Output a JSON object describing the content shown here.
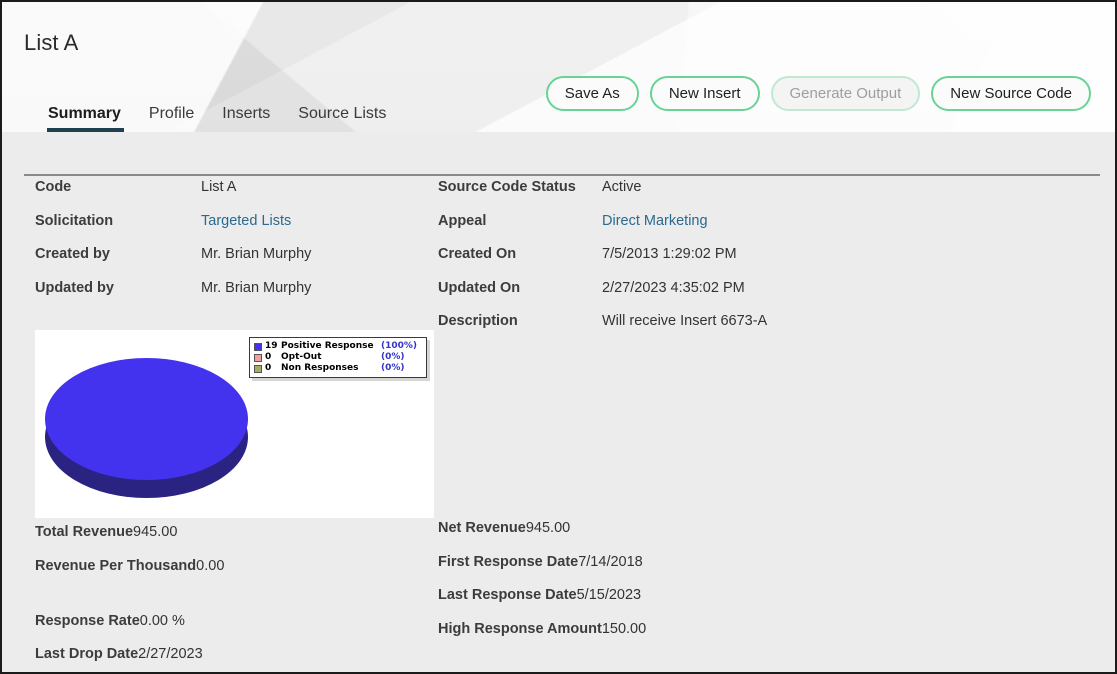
{
  "header": {
    "title": "List A"
  },
  "actions": [
    {
      "label": "Save As",
      "state": "enabled"
    },
    {
      "label": "New Insert",
      "state": "enabled"
    },
    {
      "label": "Generate Output",
      "state": "disabled"
    },
    {
      "label": "New Source Code",
      "state": "enabled"
    }
  ],
  "tabs": [
    {
      "label": "Summary",
      "active": true
    },
    {
      "label": "Profile",
      "active": false
    },
    {
      "label": "Inserts",
      "active": false
    },
    {
      "label": "Source Lists",
      "active": false
    }
  ],
  "details": {
    "left_top": [
      {
        "label": "Code",
        "value": "List A",
        "link": false
      },
      {
        "label": "Solicitation",
        "value": "Targeted Lists",
        "link": true
      },
      {
        "label": "Created by",
        "value": "Mr. Brian Murphy",
        "link": false
      },
      {
        "label": "Updated by",
        "value": "Mr. Brian Murphy",
        "link": false
      }
    ],
    "right_top": [
      {
        "label": "Source Code Status",
        "value": "Active",
        "link": false
      },
      {
        "label": "Appeal",
        "value": "Direct Marketing",
        "link": true
      },
      {
        "label": "Created On",
        "value": "7/5/2013 1:29:02 PM",
        "link": false
      },
      {
        "label": "Updated On",
        "value": "2/27/2023 4:35:02 PM",
        "link": false
      },
      {
        "label": "Description",
        "value": "Will receive Insert 6673-A",
        "link": false
      }
    ],
    "left_bottom": [
      {
        "label": "Total Revenue",
        "value": "945.00"
      },
      {
        "label": "Revenue Per Thousand",
        "value": "0.00"
      },
      {
        "label": "Response Rate",
        "value": "0.00 %"
      },
      {
        "label": "Last Drop Date",
        "value": "2/27/2023"
      }
    ],
    "right_bottom": [
      {
        "label": "Net Revenue",
        "value": "945.00"
      },
      {
        "label": "First Response Date",
        "value": "7/14/2018"
      },
      {
        "label": "Last Response Date",
        "value": "5/15/2023"
      },
      {
        "label": "High Response Amount",
        "value": "150.00"
      }
    ]
  },
  "chart_data": {
    "type": "pie",
    "title": "",
    "three_d": true,
    "legend_position": "top-right",
    "categories": [
      "Positive Response",
      "Opt-Out",
      "Non Responses"
    ],
    "values": [
      19,
      0,
      0
    ],
    "percents": [
      "(100%)",
      "(0%)",
      "(0%)"
    ],
    "counts": [
      "19",
      "0",
      "0"
    ],
    "colors": [
      "#4433ee",
      "#f2a0a0",
      "#a8ab63"
    ],
    "side_color": "#2b2382"
  },
  "colors": {
    "accent_green": "#68d395",
    "accent_green_disabled": "#bfe9d2",
    "tab_underline": "#1f4050",
    "link": "#2a6a8e",
    "label": "#3c3c3c",
    "value": "#333333",
    "background": "#ececec",
    "pie_blue": "#4433ee",
    "pie_blue_dark": "#2b2382",
    "legend_percent": "#3333cc"
  }
}
